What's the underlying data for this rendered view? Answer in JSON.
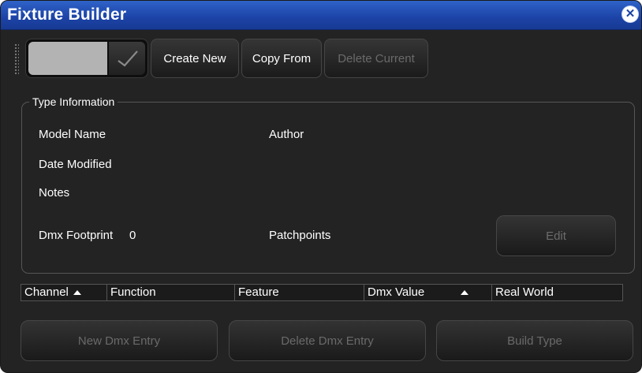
{
  "window": {
    "title": "Fixture Builder"
  },
  "toolbar": {
    "swatch_color": "#b3b3b3",
    "create_new": "Create New",
    "copy_from": "Copy From",
    "delete_current": "Delete Current"
  },
  "type_info": {
    "legend": "Type Information",
    "model_name_label": "Model Name",
    "author_label": "Author",
    "date_modified_label": "Date Modified",
    "notes_label": "Notes",
    "dmx_footprint_label": "Dmx Footprint",
    "dmx_footprint_value": "0",
    "patchpoints_label": "Patchpoints",
    "edit_button": "Edit"
  },
  "table": {
    "columns": [
      "Channel",
      "Function",
      "Feature",
      "Dmx Value",
      "Real World"
    ],
    "sorted_columns": [
      "Channel",
      "Dmx Value"
    ]
  },
  "actions": {
    "new_dmx_entry": "New Dmx Entry",
    "delete_dmx_entry": "Delete Dmx Entry",
    "build_type": "Build Type"
  },
  "colors": {
    "title_bar": "#1c43a6",
    "panel": "#232323",
    "disabled_text": "#6a6a6a"
  },
  "icons": {
    "close": "close-circle-icon",
    "dropdown": "chevron-down-icon",
    "sort": "sort-ascending-icon"
  }
}
